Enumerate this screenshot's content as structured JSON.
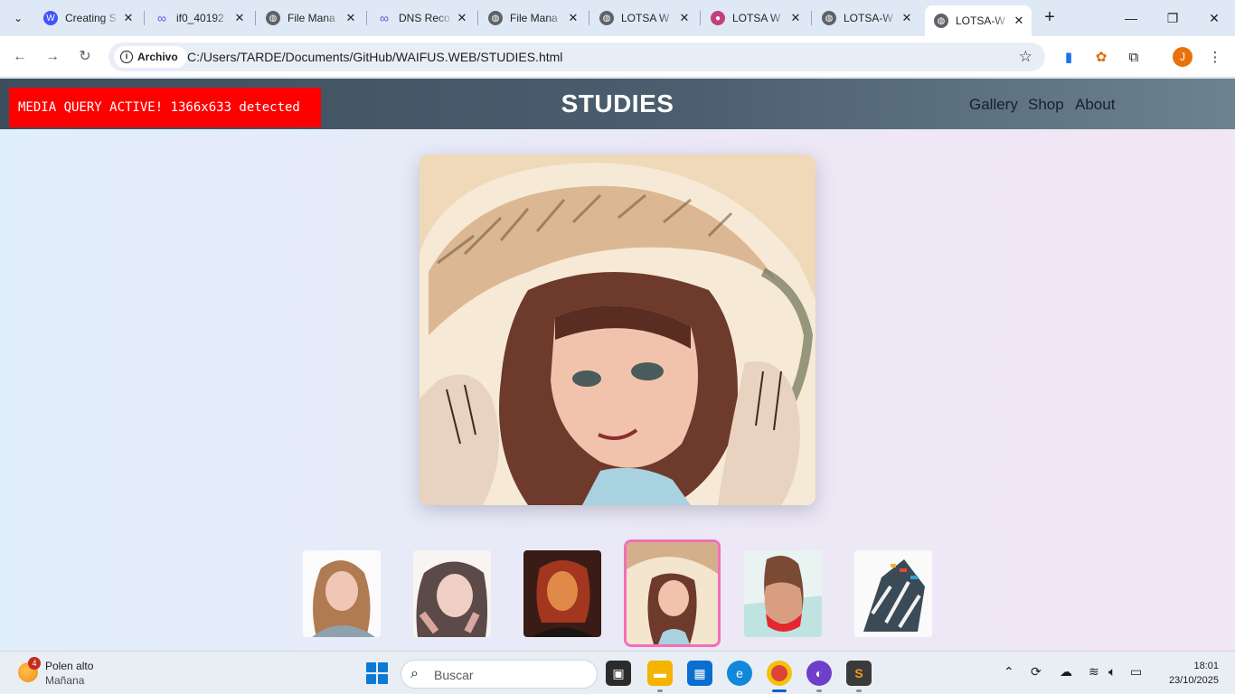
{
  "browser": {
    "tabs": [
      {
        "title": "Creating S",
        "icon": "webflow-icon",
        "color": "#4353ff"
      },
      {
        "title": "if0_40192",
        "icon": "infinity-icon",
        "color": "#6b4fd8"
      },
      {
        "title": "File Mana",
        "icon": "globe-icon",
        "color": "#5f6368"
      },
      {
        "title": "DNS Reco",
        "icon": "infinity-icon",
        "color": "#6b4fd8"
      },
      {
        "title": "File Mana",
        "icon": "globe-icon",
        "color": "#5f6368"
      },
      {
        "title": "LOTSA W",
        "icon": "globe-icon",
        "color": "#5f6368"
      },
      {
        "title": "LOTSA W",
        "icon": "avatar-icon",
        "color": "#c2407a"
      },
      {
        "title": "LOTSA-W",
        "icon": "globe-icon",
        "color": "#5f6368"
      },
      {
        "title": "LOTSA-W",
        "icon": "globe-icon",
        "color": "#5f6368",
        "active": true
      }
    ],
    "site_info_label": "Archivo",
    "url": "C:/Users/TARDE/Documents/GitHub/WAIFUS.WEB/STUDIES.html",
    "profile_initial": "J"
  },
  "site": {
    "media_query_banner": "MEDIA QUERY ACTIVE! 1366x633 detected",
    "title": "STUDIES",
    "nav": [
      "Gallery",
      "Shop",
      "About"
    ]
  },
  "gallery": {
    "selected_index": 3,
    "thumbnails": [
      {
        "name": "girl-grey-shirt-portrait"
      },
      {
        "name": "girl-hands-on-face"
      },
      {
        "name": "girl-warm-light"
      },
      {
        "name": "girl-straw-hat"
      },
      {
        "name": "girl-red-bikini-back"
      },
      {
        "name": "abstract-figure-sketch"
      }
    ]
  },
  "taskbar": {
    "weather_title": "Polen alto",
    "weather_subtitle": "Mañana",
    "weather_badge": "4",
    "search_placeholder": "Buscar",
    "time": "18:01",
    "date": "23/10/2025"
  },
  "colors": {
    "header_bg": "#3d4f5e",
    "banner_red": "#ff0000",
    "thumb_selected_border": "#f36fb5"
  }
}
